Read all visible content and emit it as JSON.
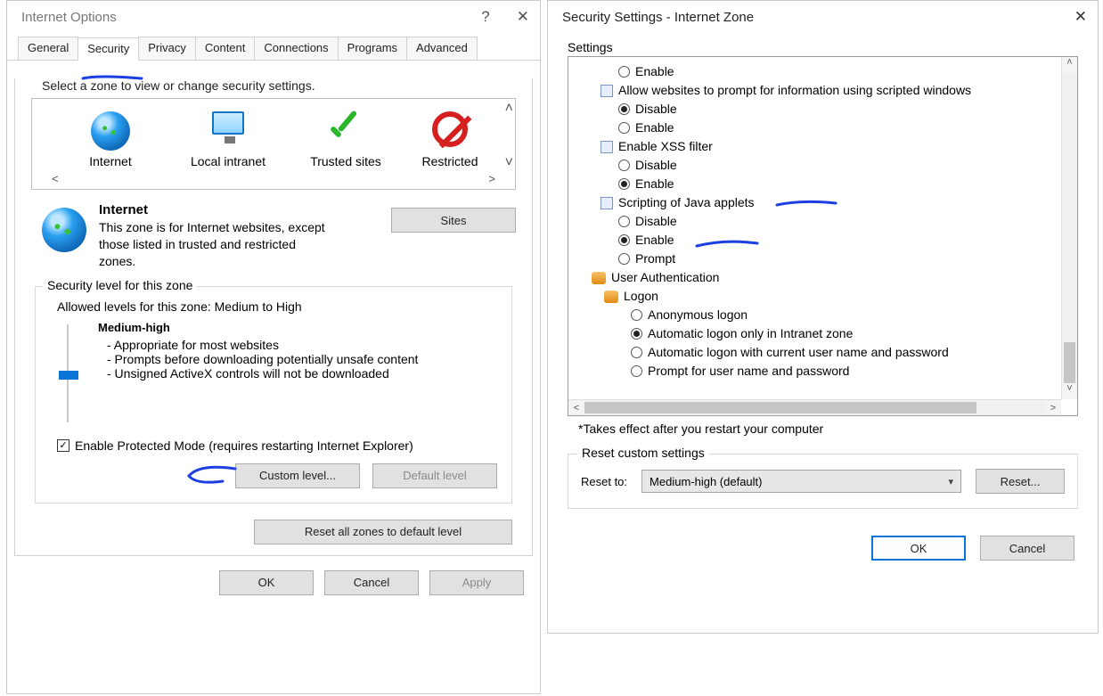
{
  "left": {
    "title": "Internet Options",
    "tabs": [
      "General",
      "Security",
      "Privacy",
      "Content",
      "Connections",
      "Programs",
      "Advanced"
    ],
    "activeTab": "Security",
    "zonePrompt": "Select a zone to view or change security settings.",
    "zones": [
      "Internet",
      "Local intranet",
      "Trusted sites",
      "Restricted"
    ],
    "zoneDesc": {
      "name": "Internet",
      "text": "This zone is for Internet websites, except those listed in trusted and restricted zones.",
      "sitesBtn": "Sites"
    },
    "levelGroup": {
      "legend": "Security level for this zone",
      "allowed": "Allowed levels for this zone: Medium to High",
      "levelName": "Medium-high",
      "bullets": [
        "- Appropriate for most websites",
        "- Prompts before downloading potentially unsafe content",
        "- Unsigned ActiveX controls will not be downloaded"
      ],
      "protected": "Enable Protected Mode (requires restarting Internet Explorer)",
      "customBtn": "Custom level...",
      "defaultBtn": "Default level"
    },
    "resetAll": "Reset all zones to default level",
    "footer": {
      "ok": "OK",
      "cancel": "Cancel",
      "apply": "Apply"
    }
  },
  "right": {
    "title": "Security Settings - Internet Zone",
    "settingsLabel": "Settings",
    "tree": [
      {
        "t": "radio",
        "sel": false,
        "label": "Enable"
      },
      {
        "t": "group",
        "label": "Allow websites to prompt for information using scripted windows"
      },
      {
        "t": "radio",
        "sel": true,
        "label": "Disable"
      },
      {
        "t": "radio",
        "sel": false,
        "label": "Enable"
      },
      {
        "t": "group",
        "label": "Enable XSS filter"
      },
      {
        "t": "radio",
        "sel": false,
        "label": "Disable"
      },
      {
        "t": "radio",
        "sel": true,
        "label": "Enable"
      },
      {
        "t": "group",
        "label": "Scripting of Java applets",
        "mark": true
      },
      {
        "t": "radio",
        "sel": false,
        "label": "Disable"
      },
      {
        "t": "radio",
        "sel": true,
        "label": "Enable",
        "mark": true
      },
      {
        "t": "radio",
        "sel": false,
        "label": "Prompt"
      },
      {
        "t": "cat",
        "label": "User Authentication"
      },
      {
        "t": "subcat",
        "label": "Logon"
      },
      {
        "t": "radio",
        "sel": false,
        "label": "Anonymous logon",
        "deep": true
      },
      {
        "t": "radio",
        "sel": true,
        "label": "Automatic logon only in Intranet zone",
        "deep": true
      },
      {
        "t": "radio",
        "sel": false,
        "label": "Automatic logon with current user name and password",
        "deep": true
      },
      {
        "t": "radio",
        "sel": false,
        "label": "Prompt for user name and password",
        "deep": true
      }
    ],
    "note": "*Takes effect after you restart your computer",
    "resetGroup": {
      "legend": "Reset custom settings",
      "label": "Reset to:",
      "value": "Medium-high (default)",
      "btn": "Reset..."
    },
    "footer": {
      "ok": "OK",
      "cancel": "Cancel"
    }
  }
}
